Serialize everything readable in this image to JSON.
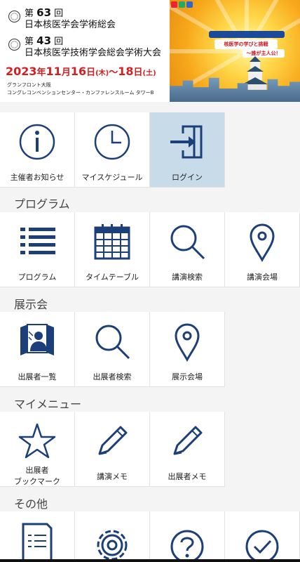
{
  "header": {
    "conf1_prefix": "第",
    "conf1_num": "63",
    "conf1_suffix": "回",
    "conf1_name": "日本核医学会学術総会",
    "conf2_prefix": "第",
    "conf2_num": "43",
    "conf2_suffix": "回",
    "conf2_name": "日本核医学技術学会総会学術大会",
    "date_year": "2023",
    "date_y": "年",
    "date_m1": "11",
    "date_mt": "月",
    "date_d1": "16",
    "date_dt": "日",
    "date_w1": "(木)",
    "date_tilde": "～",
    "date_d2": "18",
    "date_dt2": "日",
    "date_w2": "(土)",
    "venue1": "グランフロント大阪",
    "venue2": "コングレコンベンションセンター・カンファレンスルーム タワーB",
    "banner_text1": "核医学の学びと挑戦",
    "banner_text2": "～誰が主人公！"
  },
  "top_tiles": [
    {
      "label": "主催者お知らせ",
      "icon": "info-icon"
    },
    {
      "label": "マイスケジュール",
      "icon": "clock-icon"
    },
    {
      "label": "ログイン",
      "icon": "login-icon"
    }
  ],
  "sections": {
    "program": "プログラム",
    "exhibition": "展示会",
    "mymenu": "マイメニュー",
    "other": "その他"
  },
  "program_tiles": [
    {
      "label": "プログラム",
      "icon": "list-icon"
    },
    {
      "label": "タイムテーブル",
      "icon": "calendar-icon"
    },
    {
      "label": "講演検索",
      "icon": "search-icon"
    },
    {
      "label": "講演会場",
      "icon": "map-pin-icon"
    }
  ],
  "exhibition_tiles": [
    {
      "label": "出展者一覧",
      "icon": "exhibitor-icon"
    },
    {
      "label": "出展者検索",
      "icon": "search-icon"
    },
    {
      "label": "展示会場",
      "icon": "map-pin-icon"
    }
  ],
  "mymenu_tiles": [
    {
      "label1": "出展者",
      "label2": "ブックマーク",
      "icon": "star-icon"
    },
    {
      "label": "講演メモ",
      "icon": "pencil-icon"
    },
    {
      "label": "出展者メモ",
      "icon": "pencil-icon"
    }
  ],
  "other_tiles": [
    {
      "icon": "document-icon"
    },
    {
      "icon": "gear-icon"
    },
    {
      "icon": "help-icon"
    },
    {
      "icon": "check-icon"
    }
  ],
  "colors": {
    "icon": "#1c3f7a",
    "active_tile": "#c8dbe9",
    "date_red": "#d21f1f"
  }
}
